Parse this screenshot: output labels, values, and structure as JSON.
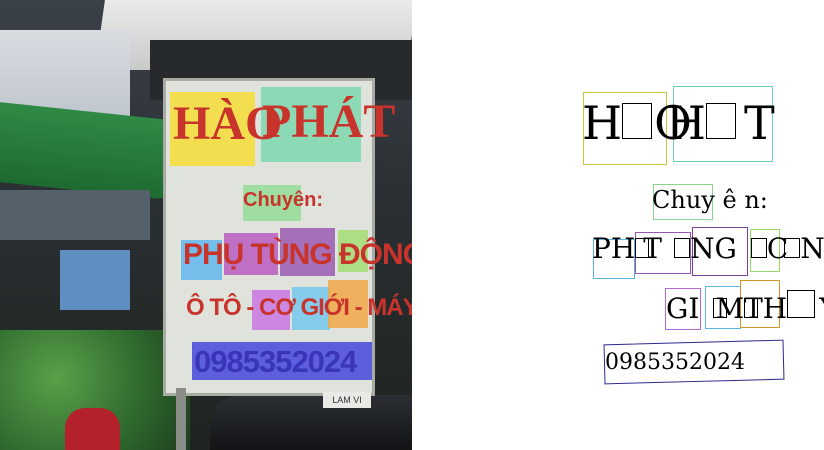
{
  "photo": {
    "sign": {
      "title_left": "HÀO",
      "title_right": "PHÁT",
      "subtitle": "Chuyên:",
      "line1": "PHỤ TÙNG ĐỘNG CƠ",
      "line2": "Ô TÔ - CƠ GIỚI - MÁY THỦY",
      "phone": "0985352024",
      "plate": "LAM VI"
    }
  },
  "ocr": {
    "line_title_a": "H",
    "line_title_b": "O",
    "line_title_c": "H",
    "line_title_d": "T",
    "subtitle_a": "Chuy",
    "subtitle_b": "ê",
    "subtitle_c": "n:",
    "line1_a": "PH",
    "line1_b": "T",
    "line1_c": "NG",
    "line1_d": "C",
    "line1_e": "NG",
    "line2_a": "GI",
    "line2_b": "M",
    "line2_c": "TH",
    "line2_d": "Y",
    "phone": "0985352024"
  },
  "colors": {
    "box_yellow": "#c8c83c",
    "box_teal": "#6fd0c0",
    "box_green": "#8ad48c",
    "box_blue": "#5ab4e0",
    "box_purple": "#9a55b8",
    "box_lime": "#9ad86a",
    "box_violet": "#b46ad6",
    "box_sky": "#5ab8e6",
    "box_orange": "#d49028",
    "box_navy": "#2a2a90"
  }
}
